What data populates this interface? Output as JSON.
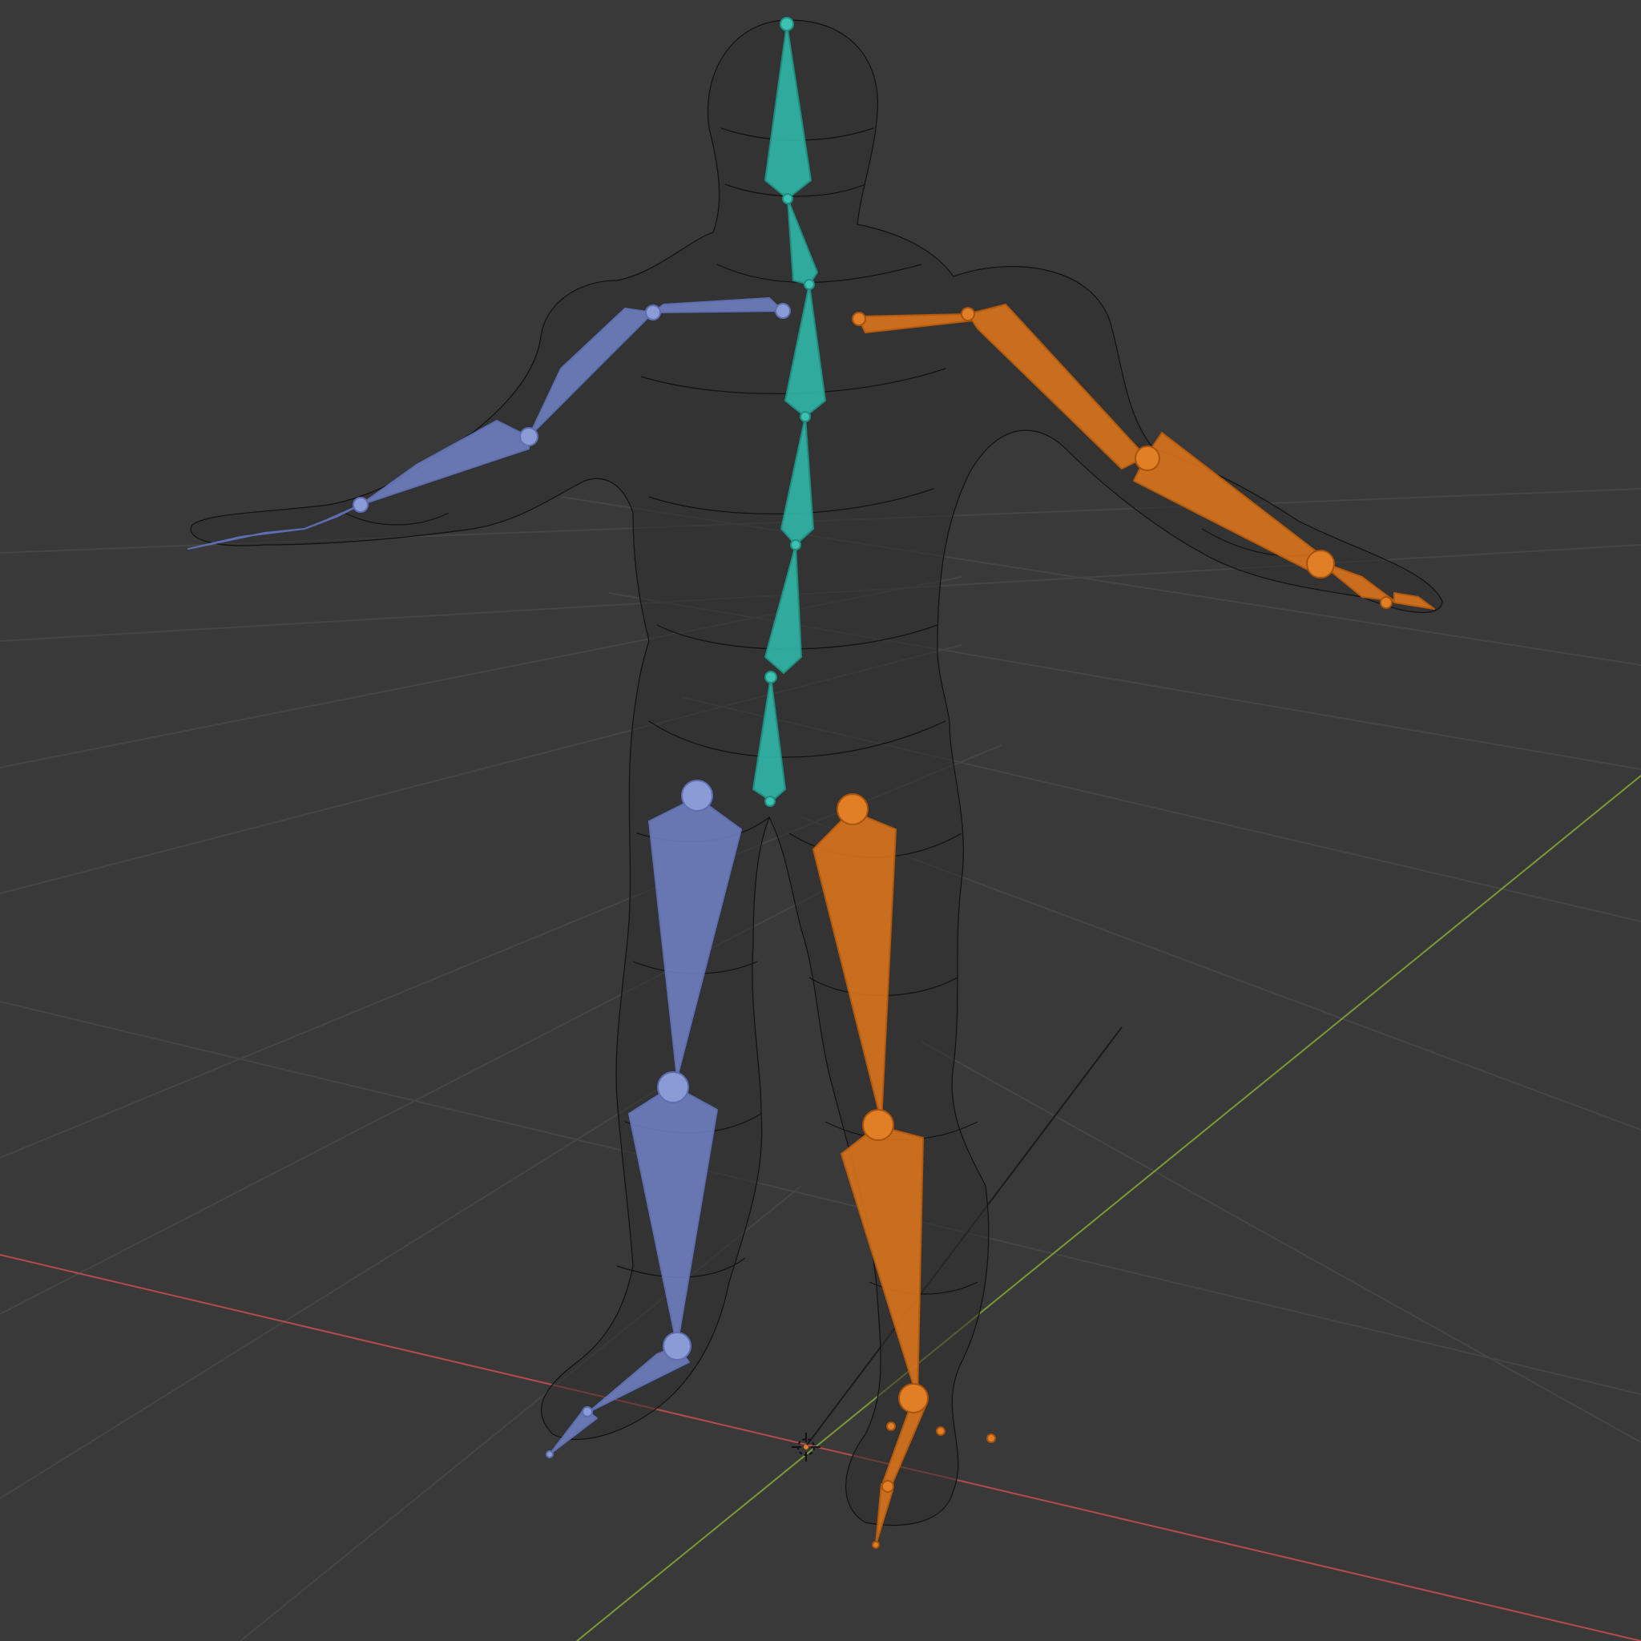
{
  "viewport": {
    "background": "#393939",
    "grid_color": "#454545",
    "axis_x_color": "#b54b4b",
    "axis_y_color": "#7a9a35"
  },
  "armature": {
    "bone_colors": {
      "left": "#7384c8",
      "right": "#d9741c",
      "spine": "#2fb4a5"
    }
  },
  "icons": [
    "3d-cursor-icon"
  ]
}
